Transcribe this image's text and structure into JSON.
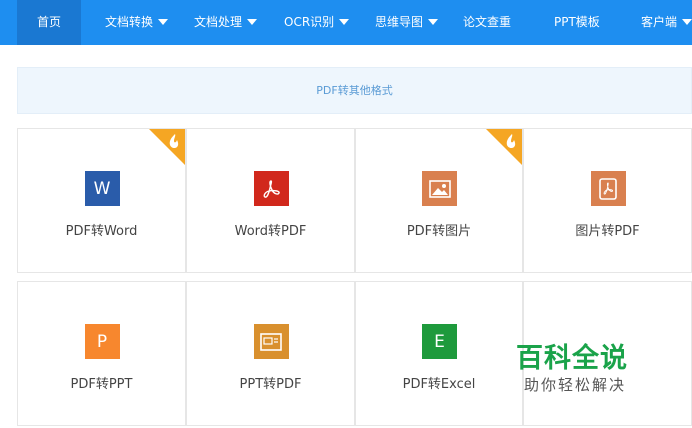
{
  "nav": {
    "items": [
      {
        "label": "首页",
        "dropdown": false,
        "active": true
      },
      {
        "label": "文档转换",
        "dropdown": true
      },
      {
        "label": "文档处理",
        "dropdown": true
      },
      {
        "label": "OCR识别",
        "dropdown": true
      },
      {
        "label": "思维导图",
        "dropdown": true
      },
      {
        "label": "论文查重",
        "dropdown": false
      },
      {
        "label": "PPT模板",
        "dropdown": false
      },
      {
        "label": "客户端",
        "dropdown": true
      }
    ],
    "colors": {
      "bar": "#1e8ef0",
      "active": "#1a78d2"
    }
  },
  "banner": {
    "text": "PDF转其他格式"
  },
  "tools": [
    {
      "label": "PDF转Word",
      "icon": "word-icon",
      "glyph": "W",
      "color": "#2a5caa",
      "hot": true
    },
    {
      "label": "Word转PDF",
      "icon": "acrobat-icon",
      "glyph": "",
      "color": "#d1281c",
      "hot": false
    },
    {
      "label": "PDF转图片",
      "icon": "image-icon",
      "glyph": "",
      "color": "#d9804f",
      "hot": true
    },
    {
      "label": "图片转PDF",
      "icon": "pdf-doc-icon",
      "glyph": "",
      "color": "#d9804f",
      "hot": false
    },
    {
      "label": "PDF转PPT",
      "icon": "powerpoint-icon",
      "glyph": "P",
      "color": "#f7872e",
      "hot": false
    },
    {
      "label": "PPT转PDF",
      "icon": "ppt-slide-icon",
      "glyph": "",
      "color": "#d9902e",
      "hot": false
    },
    {
      "label": "PDF转Excel",
      "icon": "excel-icon",
      "glyph": "E",
      "color": "#1e9a3c",
      "hot": false
    }
  ],
  "watermark": {
    "title": "百科全说",
    "subtitle": "助你轻松解决"
  }
}
